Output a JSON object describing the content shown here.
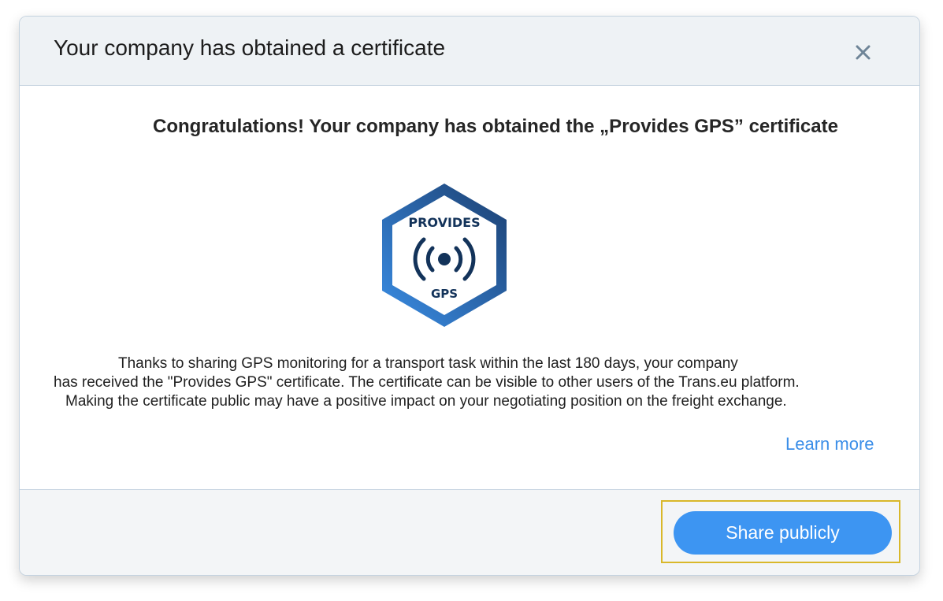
{
  "dialog": {
    "title": "Your company has obtained a certificate",
    "close_icon": "close-icon"
  },
  "body": {
    "headline": "Congratulations! Your company has obtained the „Provides GPS” certificate",
    "badge": {
      "top_text": "PROVIDES",
      "bottom_text": "GPS",
      "icon": "gps-broadcast-icon",
      "colors": {
        "outline_start": "#3a8ee6",
        "outline_end": "#1c3f70",
        "ink": "#13335a"
      }
    },
    "description_lines": [
      "Thanks to sharing GPS monitoring for a transport task within the last 180 days, your company",
      "has received the \"Provides GPS\" certificate. The certificate can be visible to other users of the Trans.eu platform.",
      "Making the certificate public may have a positive impact on your negotiating position on the freight exchange."
    ],
    "learn_more": "Learn more"
  },
  "footer": {
    "share_button": "Share publicly",
    "colors": {
      "button": "#3d95f2",
      "highlight": "#d9b82a"
    }
  }
}
